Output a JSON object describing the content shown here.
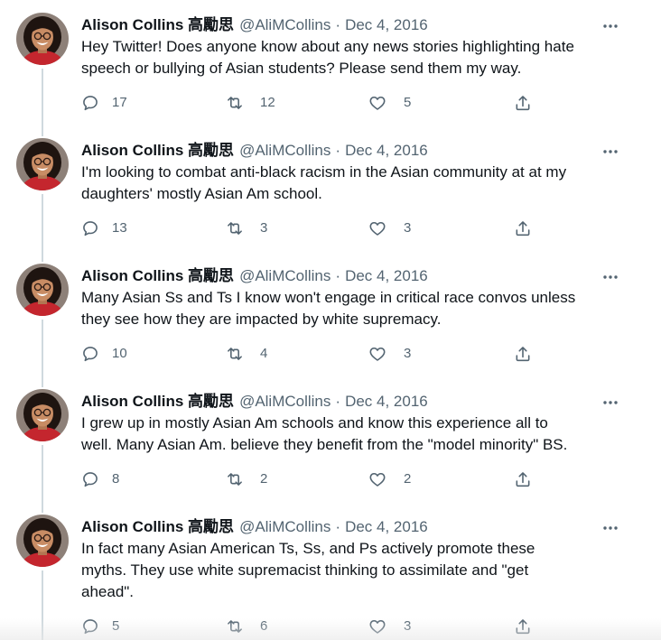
{
  "author": {
    "name": "Alison Collins 高勵思",
    "handle": "@AliMCollins",
    "separator": "·"
  },
  "icons": {
    "avatar": "avatar",
    "more": "more-icon",
    "reply": "reply-icon",
    "retweet": "retweet-icon",
    "like": "like-icon",
    "share": "share-icon"
  },
  "colors": {
    "text": "#0f1419",
    "muted": "#536471",
    "thread_line": "#cfd9de",
    "background": "#ffffff",
    "avatar_shirt": "#c4262e"
  },
  "tweets": [
    {
      "date": "Dec 4, 2016",
      "lines": [
        "Hey Twitter! Does anyone know about any news stories highlighting hate",
        "speech or bullying of Asian students? Please send them my way."
      ],
      "replies": "17",
      "retweets": "12",
      "likes": "5"
    },
    {
      "date": "Dec 4, 2016",
      "lines": [
        "I'm looking to combat anti-black racism in the Asian community at at my",
        "daughters' mostly Asian Am school."
      ],
      "replies": "13",
      "retweets": "3",
      "likes": "3"
    },
    {
      "date": "Dec 4, 2016",
      "lines": [
        "Many Asian Ss and Ts I know won't engage in critical race convos unless",
        "they see how they are impacted by white supremacy."
      ],
      "replies": "10",
      "retweets": "4",
      "likes": "3"
    },
    {
      "date": "Dec 4, 2016",
      "lines": [
        "I grew up in mostly Asian Am schools and know this experience all to",
        "well. Many Asian Am. believe they benefit from the \"model minority\" BS."
      ],
      "replies": "8",
      "retweets": "2",
      "likes": "2"
    },
    {
      "date": "Dec 4, 2016",
      "lines": [
        "In fact many Asian American Ts, Ss, and Ps actively promote these",
        "myths. They use white supremacist thinking to assimilate and \"get",
        "ahead\"."
      ],
      "replies": "5",
      "retweets": "6",
      "likes": "3"
    }
  ]
}
